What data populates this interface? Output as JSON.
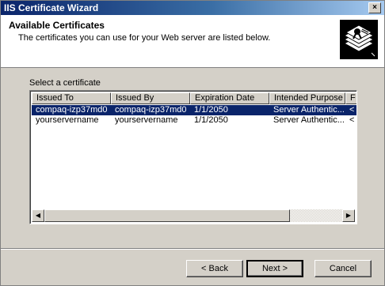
{
  "window": {
    "title": "IIS Certificate Wizard",
    "close_glyph": "×"
  },
  "header": {
    "title": "Available Certificates",
    "subtitle": "The certificates you can use for your Web server are listed below.",
    "icon": "certificate-stack-icon"
  },
  "list": {
    "label": "Select a certificate",
    "columns": [
      "Issued To",
      "Issued By",
      "Expiration Date",
      "Intended Purpose",
      "F"
    ],
    "rows": [
      [
        "compaq-izp37md0",
        "compaq-izp37md0",
        "1/1/2050",
        "Server Authentic...",
        "<"
      ],
      [
        "yourservername",
        "yourservername",
        "1/1/2050",
        "Server Authentic...",
        "<"
      ]
    ],
    "selected_row": 0,
    "scroll_left_glyph": "◀",
    "scroll_right_glyph": "▶"
  },
  "buttons": {
    "back": "< Back",
    "next": "Next >",
    "cancel": "Cancel"
  },
  "colors": {
    "title_bar": "#0a246a",
    "selection": "#0a246a",
    "face": "#d4d0c8"
  }
}
